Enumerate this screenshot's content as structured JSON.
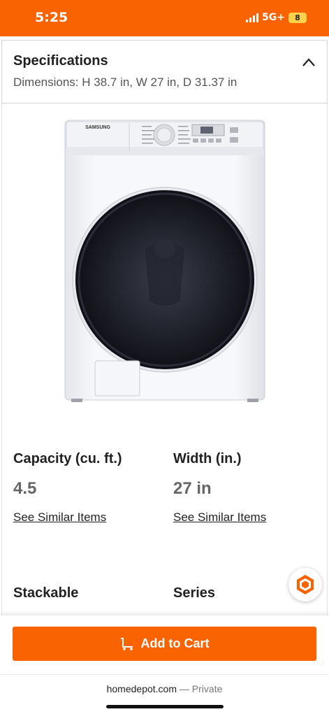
{
  "status_bar": {
    "time": "5:25",
    "network": "5G+",
    "battery": "8"
  },
  "specs": {
    "title": "Specifications",
    "dimensions": "Dimensions: H 38.7 in, W 27 in, D 31.37 in"
  },
  "product_image": {
    "brand_text": "SAMSUNG"
  },
  "spec_items": [
    {
      "label": "Capacity (cu. ft.)",
      "value": "4.5",
      "link": "See Similar Items"
    },
    {
      "label": "Width (in.)",
      "value": "27 in",
      "link": "See Similar Items"
    },
    {
      "label": "Stackable"
    },
    {
      "label": "Series"
    }
  ],
  "cart": {
    "label": "Add to Cart"
  },
  "browser": {
    "domain": "homedepot.com",
    "private_label": "— Private"
  },
  "colors": {
    "accent": "#f96302",
    "battery": "#fbd24a"
  }
}
